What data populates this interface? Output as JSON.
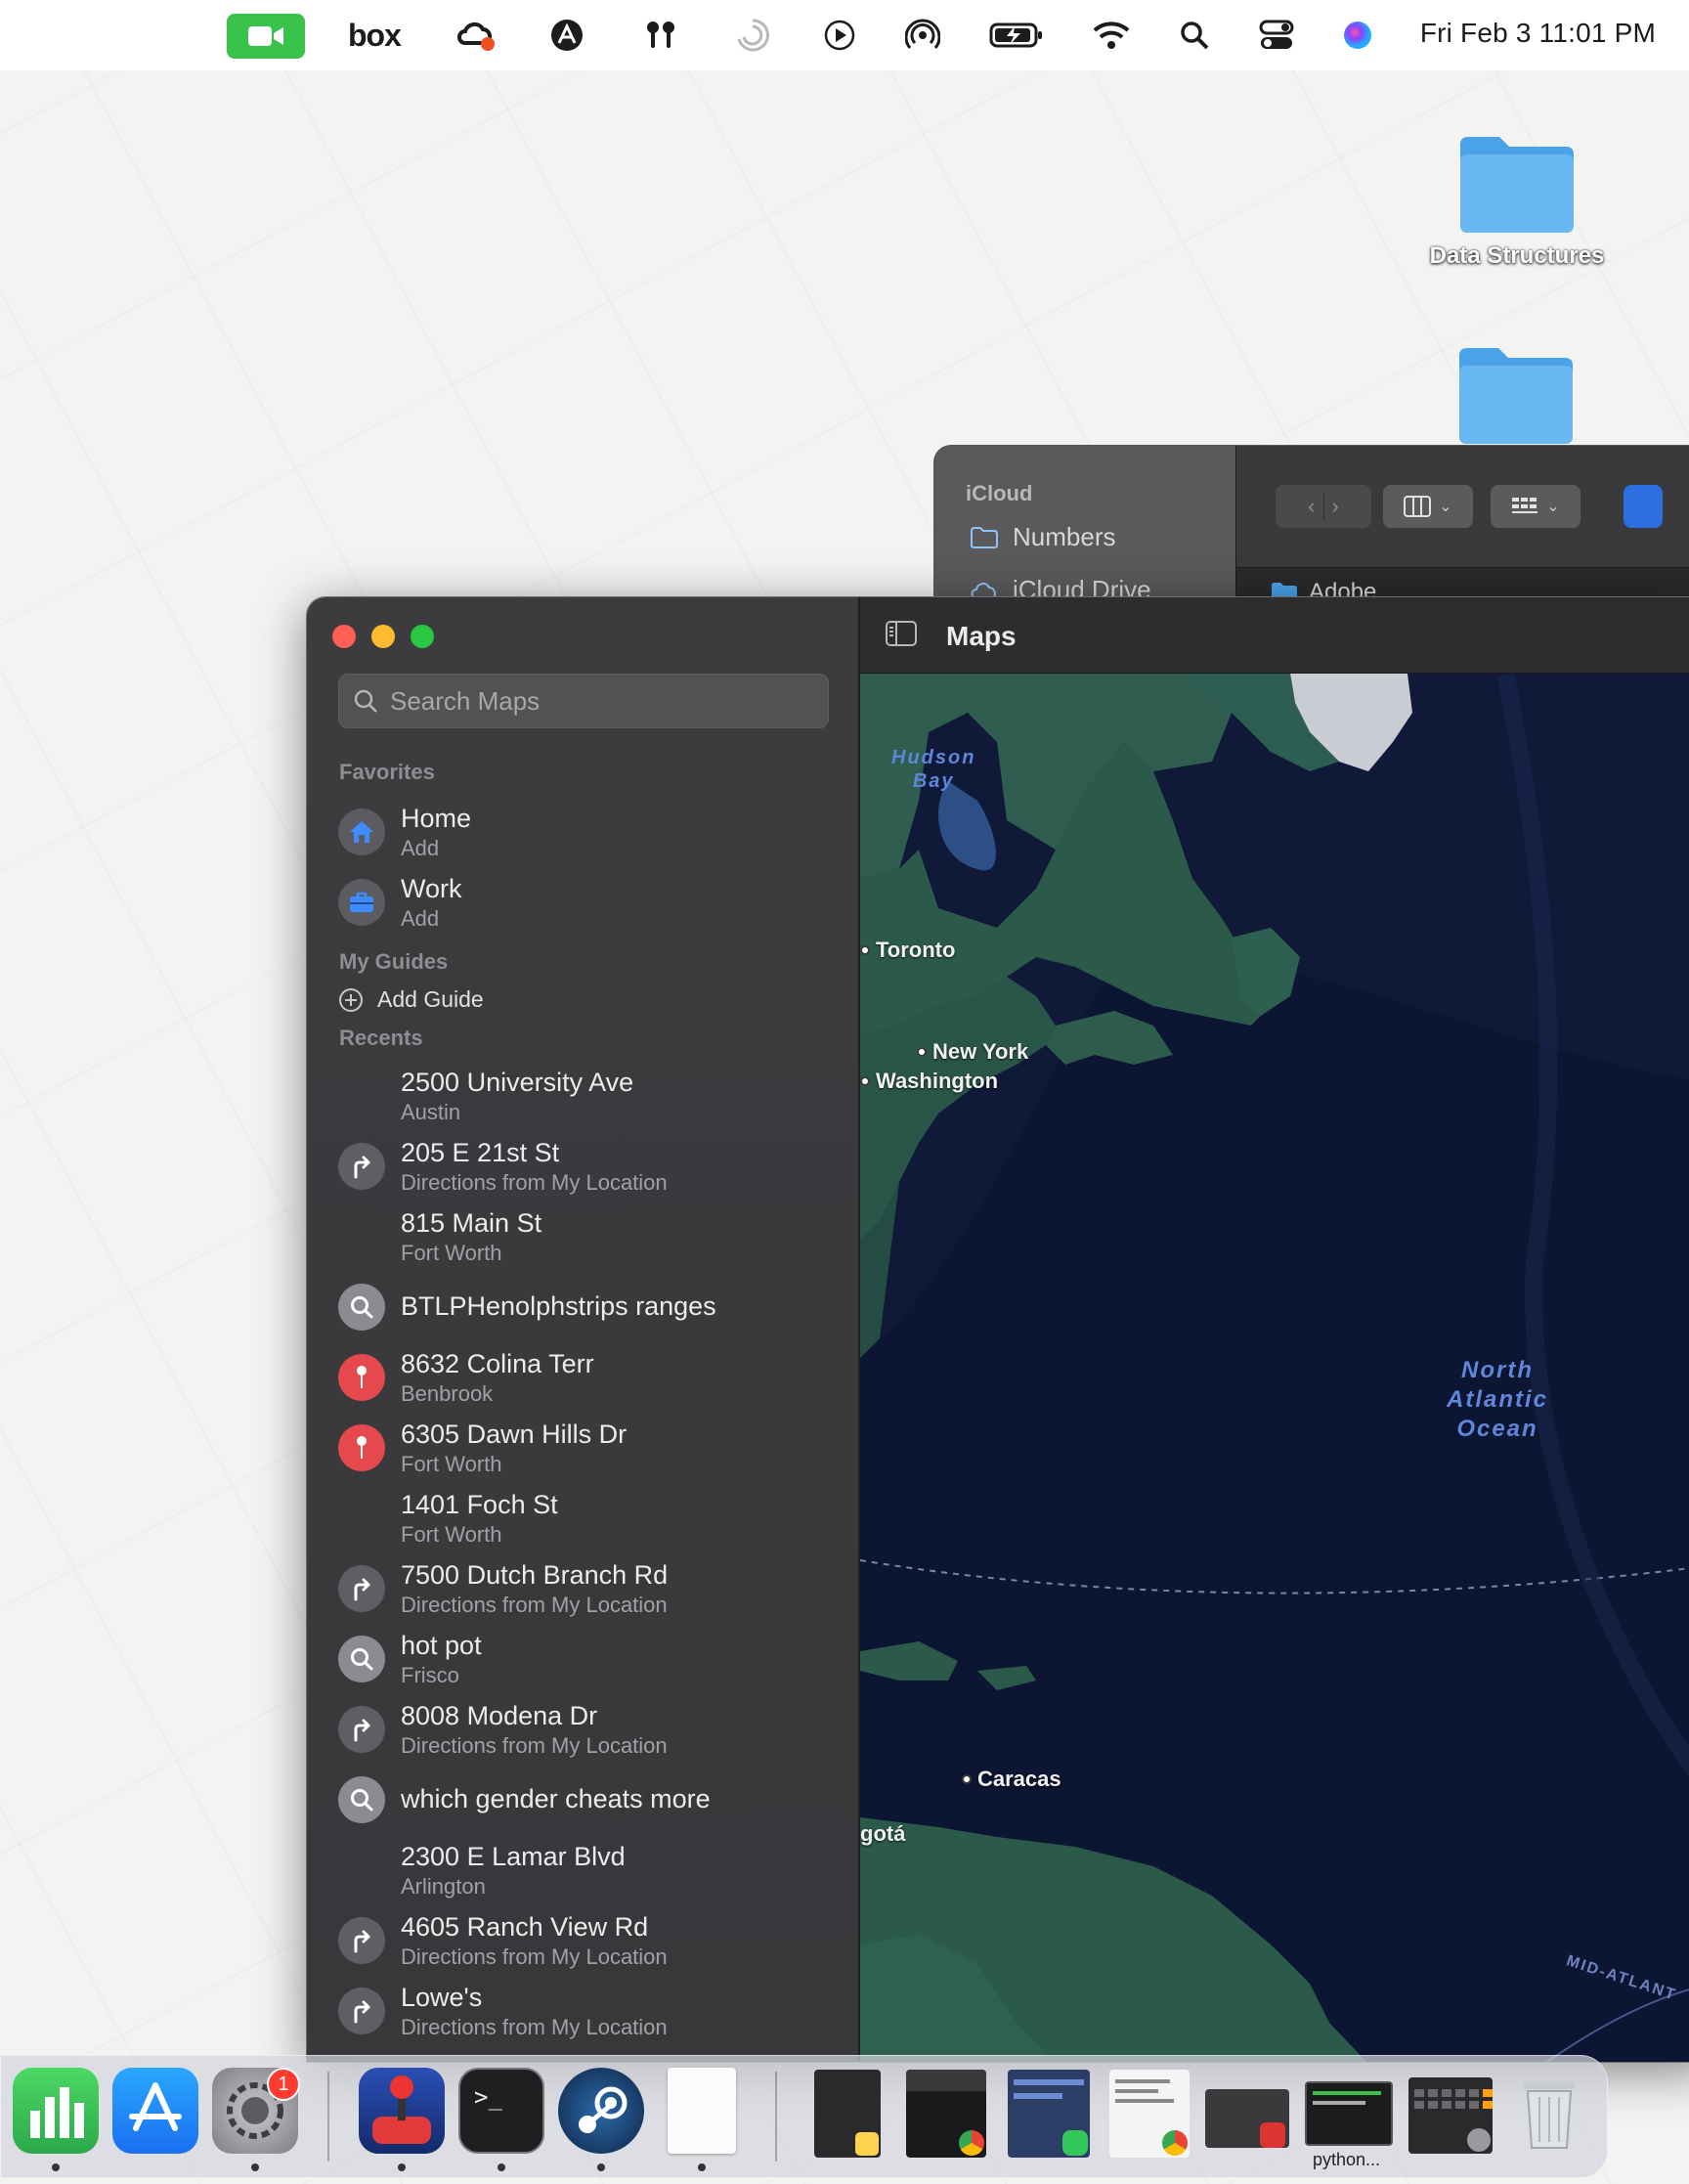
{
  "menubar": {
    "icons": [
      "facetime-icon",
      "box-icon",
      "creative-cloud-icon",
      "adobe-acrobat-icon",
      "airpods-icon",
      "spinner-icon",
      "play-icon",
      "airdrop-icon",
      "battery-icon",
      "wifi-icon",
      "search-icon",
      "control-center-icon",
      "siri-icon"
    ],
    "box_label": "box",
    "clock": "Fri Feb 3  11:01 PM"
  },
  "desktop": {
    "folders": [
      {
        "label": "Data Structures"
      },
      {
        "label": ""
      }
    ]
  },
  "finder": {
    "section": "iCloud",
    "items": [
      "Numbers",
      "iCloud Drive"
    ],
    "first_file": "Adobe"
  },
  "maps": {
    "title": "Maps",
    "search_placeholder": "Search Maps",
    "favorites_header": "Favorites",
    "favorites": [
      {
        "title": "Home",
        "subtitle": "Add",
        "icon": "house-icon"
      },
      {
        "title": "Work",
        "subtitle": "Add",
        "icon": "briefcase-icon"
      }
    ],
    "guides_header": "My Guides",
    "add_guide": "Add Guide",
    "recents_header": "Recents",
    "recents": [
      {
        "title": "2500 University Ave",
        "subtitle": "Austin",
        "icon": "none"
      },
      {
        "title": "205 E 21st St",
        "subtitle": "Directions from My Location",
        "icon": "directions-icon"
      },
      {
        "title": "815 Main St",
        "subtitle": "Fort Worth",
        "icon": "none"
      },
      {
        "title": "BTLPHenolphstrips ranges",
        "subtitle": "",
        "icon": "search-icon"
      },
      {
        "title": "8632 Colina Terr",
        "subtitle": "Benbrook",
        "icon": "pin-icon"
      },
      {
        "title": "6305 Dawn Hills Dr",
        "subtitle": "Fort Worth",
        "icon": "pin-icon"
      },
      {
        "title": "1401 Foch St",
        "subtitle": "Fort Worth",
        "icon": "none"
      },
      {
        "title": "7500 Dutch Branch Rd",
        "subtitle": "Directions from My Location",
        "icon": "directions-icon"
      },
      {
        "title": "hot pot",
        "subtitle": "Frisco",
        "icon": "search-icon"
      },
      {
        "title": "8008 Modena Dr",
        "subtitle": "Directions from My Location",
        "icon": "directions-icon"
      },
      {
        "title": "which gender cheats more",
        "subtitle": "",
        "icon": "search-icon"
      },
      {
        "title": "2300 E Lamar Blvd",
        "subtitle": "Arlington",
        "icon": "none"
      },
      {
        "title": "4605 Ranch View Rd",
        "subtitle": "Directions from My Location",
        "icon": "directions-icon"
      },
      {
        "title": "Lowe's",
        "subtitle": "Directions from My Location",
        "icon": "directions-icon"
      }
    ],
    "map_labels": {
      "hudson_bay": "Hudson\nBay",
      "toronto": "Toronto",
      "new_york": "New York",
      "washington": "Washington",
      "north_atlantic": "North\nAtlantic\nOcean",
      "caracas": "Caracas",
      "bogota": "gotá",
      "mid_atlantic": "MID-ATLANT"
    }
  },
  "dock": {
    "apps": [
      "numbers-icon",
      "app-store-icon",
      "system-settings-icon",
      "joystick-app-icon",
      "terminal-icon",
      "steam-icon",
      "document-icon"
    ],
    "settings_badge": "1",
    "terminal_prompt": ">_",
    "window_thumbs": [
      "notes-window",
      "chrome-window",
      "messages-window",
      "chrome-window-2",
      "app-window",
      "python-window",
      "calculator-window"
    ],
    "python_label": "python...",
    "trash": "trash-icon",
    "colors": {
      "numbers": "#34c759",
      "appstore": "#1e88ff",
      "steam": "#1b2838"
    }
  }
}
